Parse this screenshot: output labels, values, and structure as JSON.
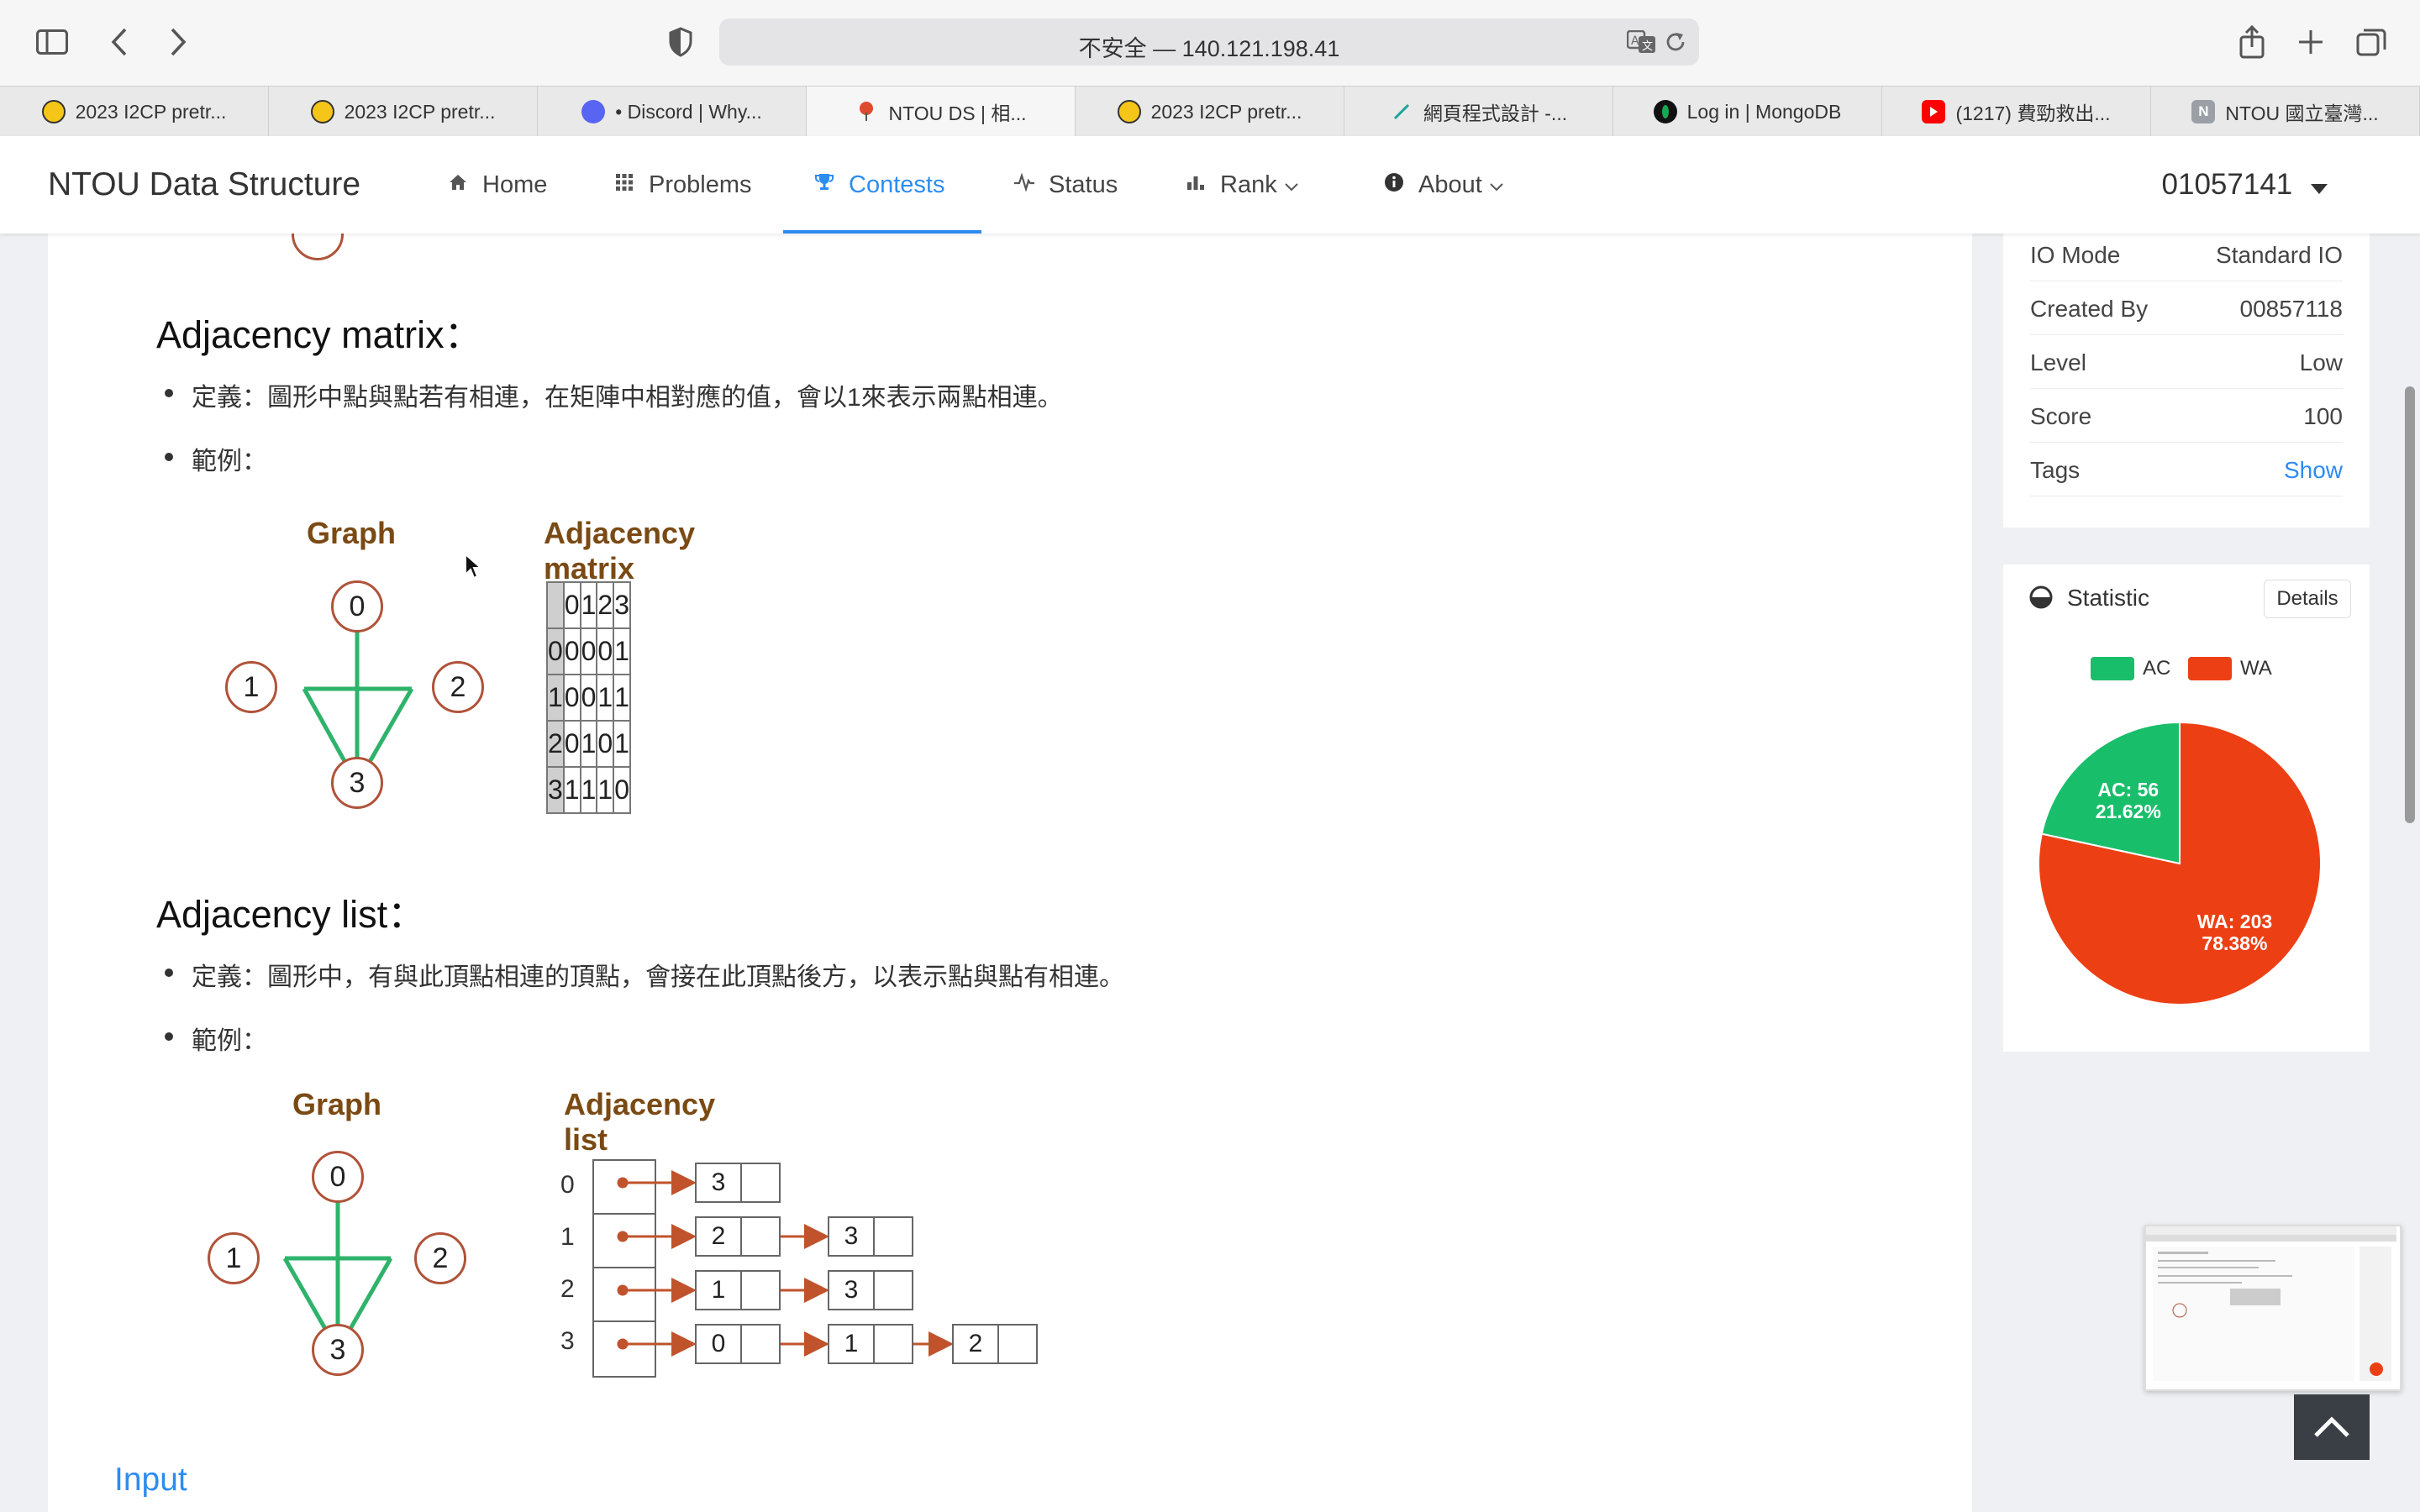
{
  "browser": {
    "url": "不安全 — 140.121.198.41",
    "tabs": [
      {
        "title": "2023 I2CP pretr...",
        "favicon": "smiley",
        "active": false
      },
      {
        "title": "2023 I2CP pretr...",
        "favicon": "smiley",
        "active": false
      },
      {
        "title": "• Discord | Why...",
        "favicon": "discord",
        "active": false
      },
      {
        "title": "NTOU DS | 相...",
        "favicon": "pin",
        "active": true
      },
      {
        "title": "2023 I2CP pretr...",
        "favicon": "smiley",
        "active": false
      },
      {
        "title": "網頁程式設計 -...",
        "favicon": "feather",
        "active": false
      },
      {
        "title": "Log in | MongoDB",
        "favicon": "leaf",
        "active": false
      },
      {
        "title": "(1217) 費勁救出...",
        "favicon": "youtube",
        "active": false
      },
      {
        "title": "NTOU 國立臺灣...",
        "favicon": "letter-n",
        "active": false
      }
    ]
  },
  "nav": {
    "brand": "NTOU Data Structure",
    "items": [
      {
        "label": "Home",
        "icon": "home-icon"
      },
      {
        "label": "Problems",
        "icon": "grid-icon"
      },
      {
        "label": "Contests",
        "icon": "trophy-icon",
        "active": true
      },
      {
        "label": "Status",
        "icon": "pulse-icon"
      },
      {
        "label": "Rank",
        "icon": "bar-chart-icon",
        "dropdown": true
      },
      {
        "label": "About",
        "icon": "info-icon",
        "dropdown": true
      }
    ],
    "user": "01057141"
  },
  "content": {
    "matrix_section": {
      "title": "Adjacency matrix：",
      "definition": "定義：圖形中點與點若有相連，在矩陣中相對應的值，會以1來表示兩點相連。",
      "example": "範例：",
      "graph_title": "Graph",
      "matrix_title": "Adjacency matrix",
      "nodes": [
        "0",
        "1",
        "2",
        "3"
      ],
      "matrix_header": [
        "0",
        "1",
        "2",
        "3"
      ],
      "matrix_rows": [
        {
          "label": "0",
          "values": [
            "0",
            "0",
            "0",
            "1"
          ]
        },
        {
          "label": "1",
          "values": [
            "0",
            "0",
            "1",
            "1"
          ]
        },
        {
          "label": "2",
          "values": [
            "0",
            "1",
            "0",
            "1"
          ]
        },
        {
          "label": "3",
          "values": [
            "1",
            "1",
            "1",
            "0"
          ]
        }
      ]
    },
    "list_section": {
      "title": "Adjacency list：",
      "definition": "定義：圖形中，有與此頂點相連的頂點，會接在此頂點後方，以表示點與點有相連。",
      "example": "範例：",
      "graph_title": "Graph",
      "list_title": "Adjacency list",
      "nodes": [
        "0",
        "1",
        "2",
        "3"
      ],
      "lists": [
        {
          "vertex": "0",
          "neighbors": [
            "3"
          ]
        },
        {
          "vertex": "1",
          "neighbors": [
            "2",
            "3"
          ]
        },
        {
          "vertex": "2",
          "neighbors": [
            "1",
            "3"
          ]
        },
        {
          "vertex": "3",
          "neighbors": [
            "0",
            "1",
            "2"
          ]
        }
      ]
    },
    "input_heading": "Input"
  },
  "info": {
    "rows": [
      {
        "key": "IO Mode",
        "value": "Standard IO"
      },
      {
        "key": "Created By",
        "value": "00857118"
      },
      {
        "key": "Level",
        "value": "Low"
      },
      {
        "key": "Score",
        "value": "100"
      },
      {
        "key": "Tags",
        "value": "Show"
      }
    ]
  },
  "statistic": {
    "title": "Statistic",
    "details_label": "Details",
    "legend": [
      {
        "label": "AC",
        "color": "#19be6b"
      },
      {
        "label": "WA",
        "color": "#ed3f14"
      }
    ],
    "slice_labels": [
      {
        "line1": "AC: 56",
        "line2": "21.62%"
      },
      {
        "line1": "WA: 203",
        "line2": "78.38%"
      }
    ]
  },
  "chart_data": {
    "type": "pie",
    "categories": [
      "AC",
      "WA"
    ],
    "values": [
      56,
      203
    ],
    "percentages": [
      21.62,
      78.38
    ],
    "colors": [
      "#19be6b",
      "#ed3f14"
    ],
    "legend": "top"
  }
}
